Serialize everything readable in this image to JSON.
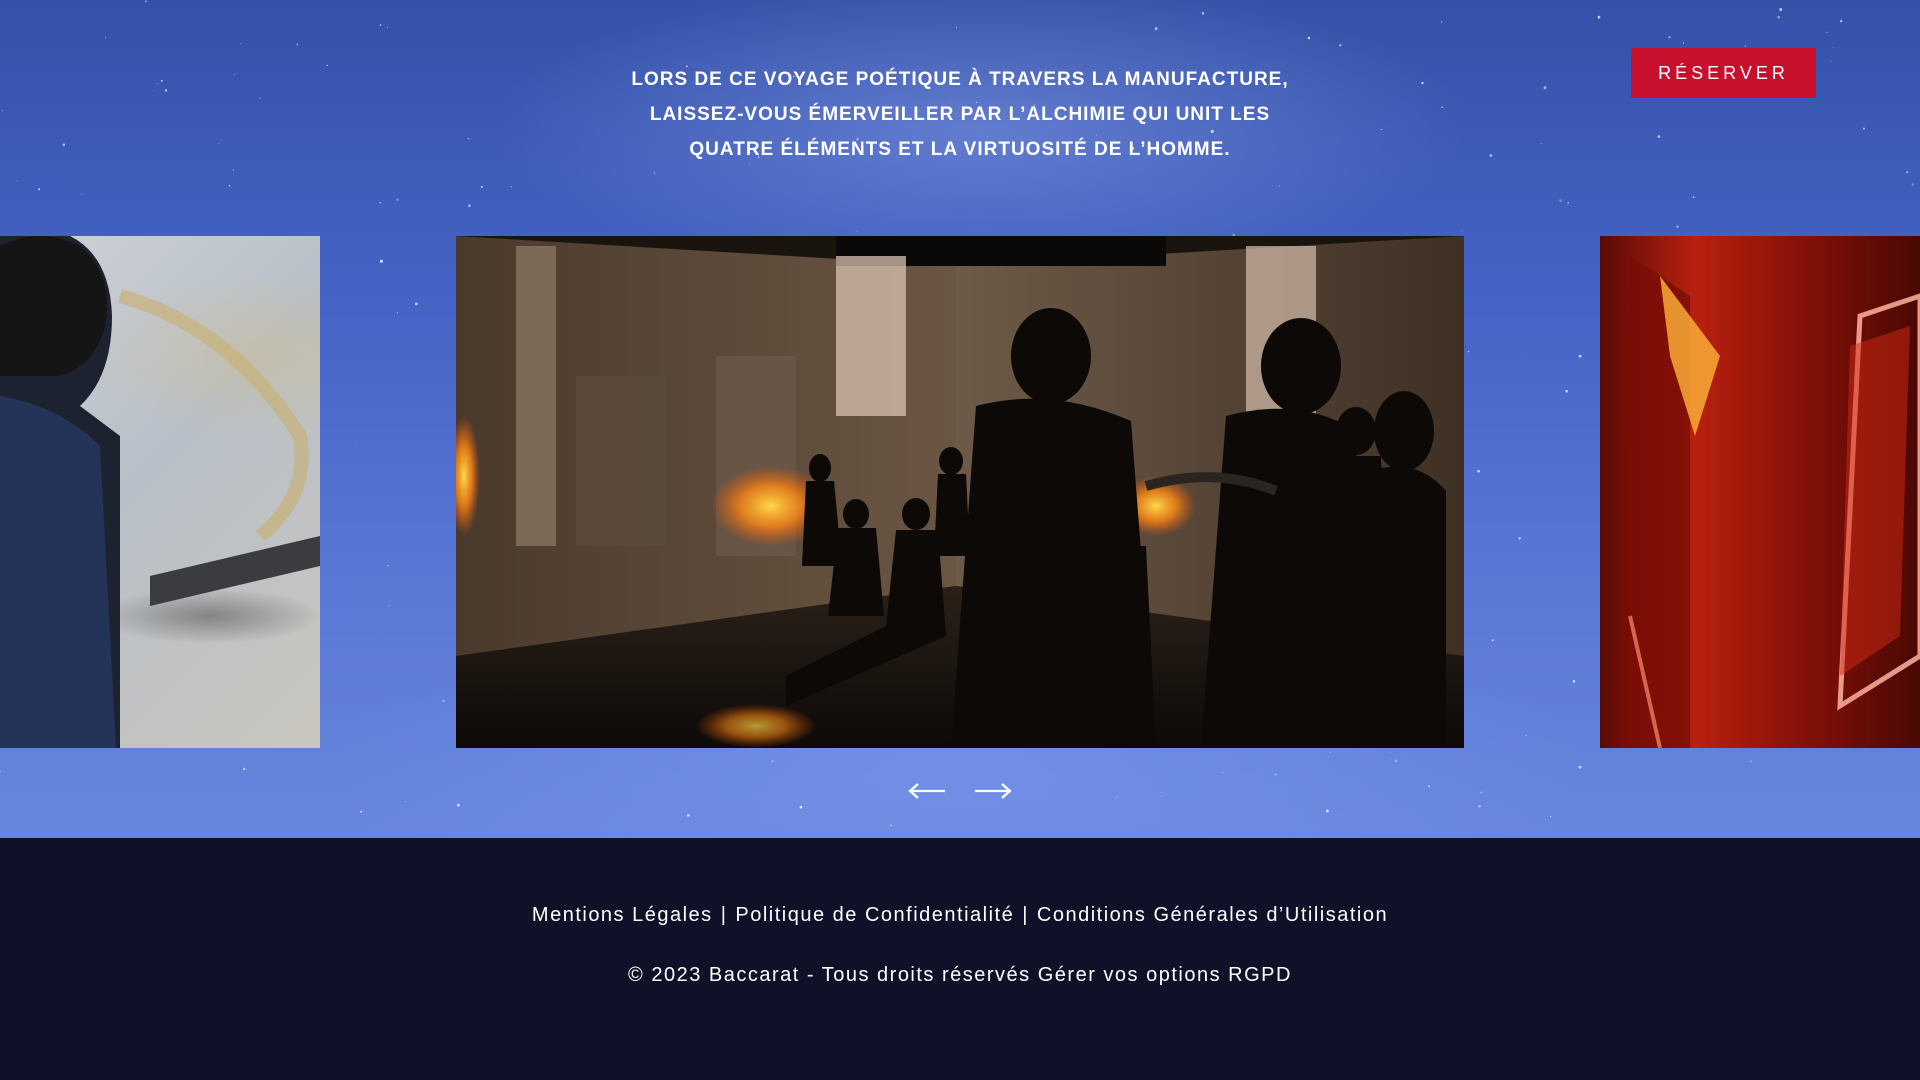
{
  "intro": {
    "lines": [
      "LORS DE CE VOYAGE POÉTIQUE À TRAVERS LA MANUFACTURE,",
      "LAISSEZ-VOUS ÉMERVEILLER PAR L’ALCHIMIE QUI UNIT LES",
      "QUATRE ÉLÉMENTS ET LA VIRTUOSITÉ DE L’HOMME."
    ]
  },
  "header": {
    "reserve_label": "RÉSERVER"
  },
  "carousel": {
    "prev_icon": "arrow-left-icon",
    "next_icon": "arrow-right-icon"
  },
  "footer": {
    "links": [
      "Mentions Légales",
      "Politique de Confidentialité",
      "Conditions Générales d’Utilisation"
    ],
    "separator": "|",
    "copyright": "© 2023 Baccarat - Tous droits réservés",
    "rgpd_link": "Gérer vos options RGPD"
  },
  "colors": {
    "accent": "#c8102e",
    "footer_bg": "#0f1128",
    "sky": "#4a68c8"
  }
}
